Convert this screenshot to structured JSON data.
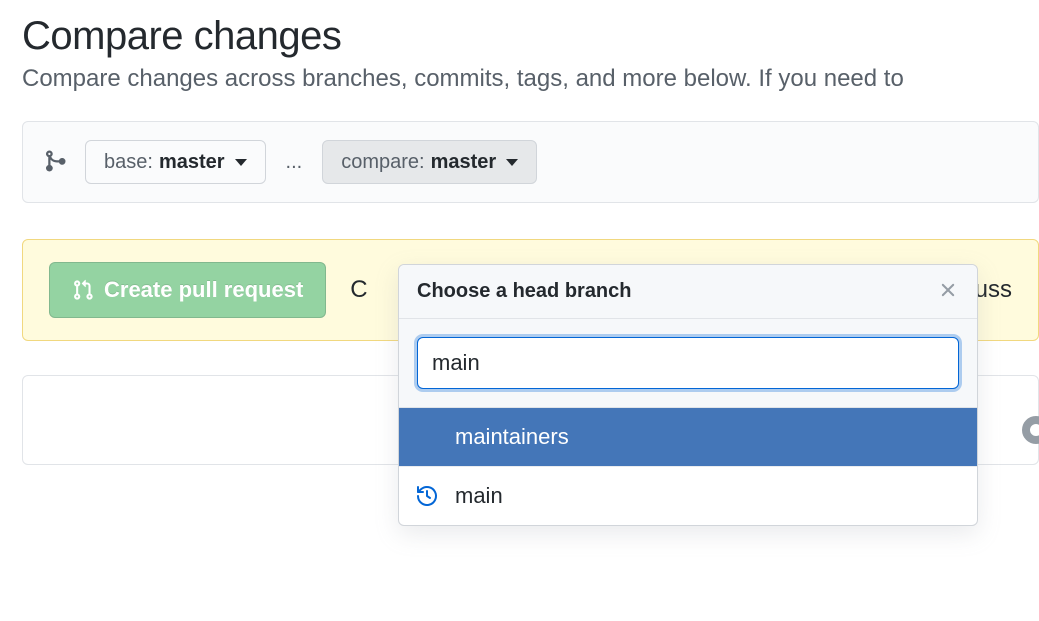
{
  "page": {
    "title": "Compare changes",
    "subtitle": "Compare changes across branches, commits, tags, and more below. If you need to"
  },
  "range": {
    "base_label": "base:",
    "base_branch": "master",
    "separator": "...",
    "compare_label": "compare:",
    "compare_branch": "master"
  },
  "flash": {
    "create_button": "Create pull request",
    "message_prefix": "C",
    "message_suffix": "uss"
  },
  "dropdown": {
    "title": "Choose a head branch",
    "search_value": "main",
    "items": [
      {
        "label": "maintainers",
        "selected": true,
        "has_history_icon": false
      },
      {
        "label": "main",
        "selected": false,
        "has_history_icon": true
      }
    ]
  },
  "icons": {
    "compare": "git-compare-icon",
    "pull_request": "git-pull-request-icon",
    "close": "x-icon",
    "history": "history-icon",
    "caret": "triangle-down-icon"
  }
}
